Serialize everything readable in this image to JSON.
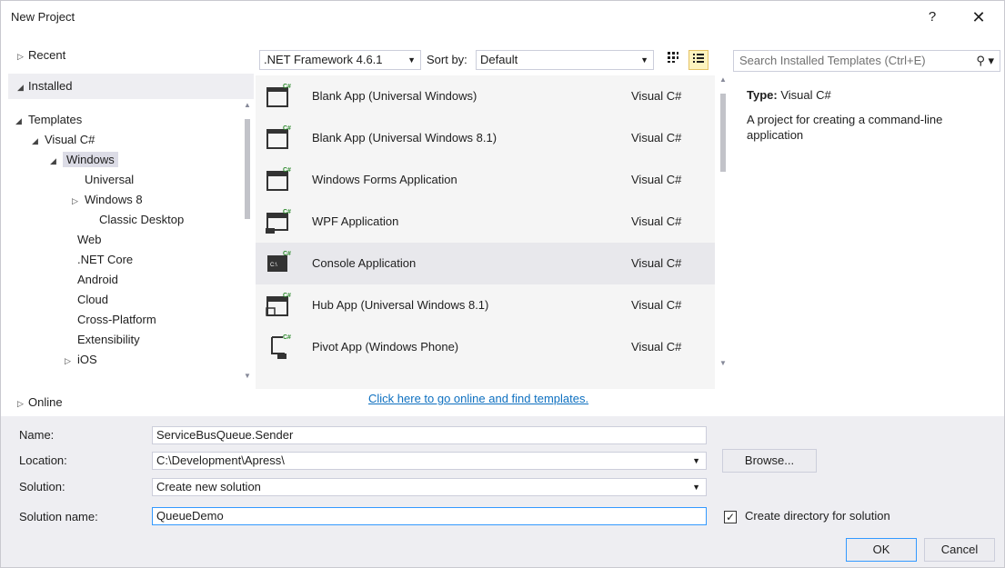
{
  "window": {
    "title": "New Project",
    "help": "?",
    "close": "✕"
  },
  "left": {
    "recent": "Recent",
    "installed": "Installed",
    "online": "Online",
    "tree": [
      {
        "label": "Templates"
      },
      {
        "label": "Visual C#"
      },
      {
        "label": "Windows"
      },
      {
        "label": "Universal"
      },
      {
        "label": "Windows 8"
      },
      {
        "label": "Classic Desktop"
      },
      {
        "label": "Web"
      },
      {
        "label": ".NET Core"
      },
      {
        "label": "Android"
      },
      {
        "label": "Cloud"
      },
      {
        "label": "Cross-Platform"
      },
      {
        "label": "Extensibility"
      },
      {
        "label": "iOS"
      }
    ]
  },
  "toolbar": {
    "framework": ".NET Framework 4.6.1",
    "sort_label": "Sort by:",
    "sort_value": "Default"
  },
  "templates": [
    {
      "name": "Blank App (Universal Windows)",
      "lang": "Visual C#"
    },
    {
      "name": "Blank App (Universal Windows 8.1)",
      "lang": "Visual C#"
    },
    {
      "name": "Windows Forms Application",
      "lang": "Visual C#"
    },
    {
      "name": "WPF Application",
      "lang": "Visual C#"
    },
    {
      "name": "Console Application",
      "lang": "Visual C#"
    },
    {
      "name": "Hub App (Universal Windows 8.1)",
      "lang": "Visual C#"
    },
    {
      "name": "Pivot App (Windows Phone)",
      "lang": "Visual C#"
    }
  ],
  "online_link": "Click here to go online and find templates.",
  "right": {
    "search_placeholder": "Search Installed Templates (Ctrl+E)",
    "type_label": "Type:",
    "type_value": "Visual C#",
    "description": "A project for creating a command-line application"
  },
  "form": {
    "name_label": "Name:",
    "name_value": "ServiceBusQueue.Sender",
    "location_label": "Location:",
    "location_value": "C:\\Development\\Apress\\",
    "solution_label": "Solution:",
    "solution_value": "Create new solution",
    "solution_name_label": "Solution name:",
    "solution_name_value": "QueueDemo",
    "browse": "Browse...",
    "create_dir": "Create directory for solution",
    "ok": "OK",
    "cancel": "Cancel"
  },
  "colors": {
    "accent": "#3399ff",
    "link": "#0e70c0",
    "selection": "#e8e8ec",
    "panel": "#eeeef2"
  }
}
